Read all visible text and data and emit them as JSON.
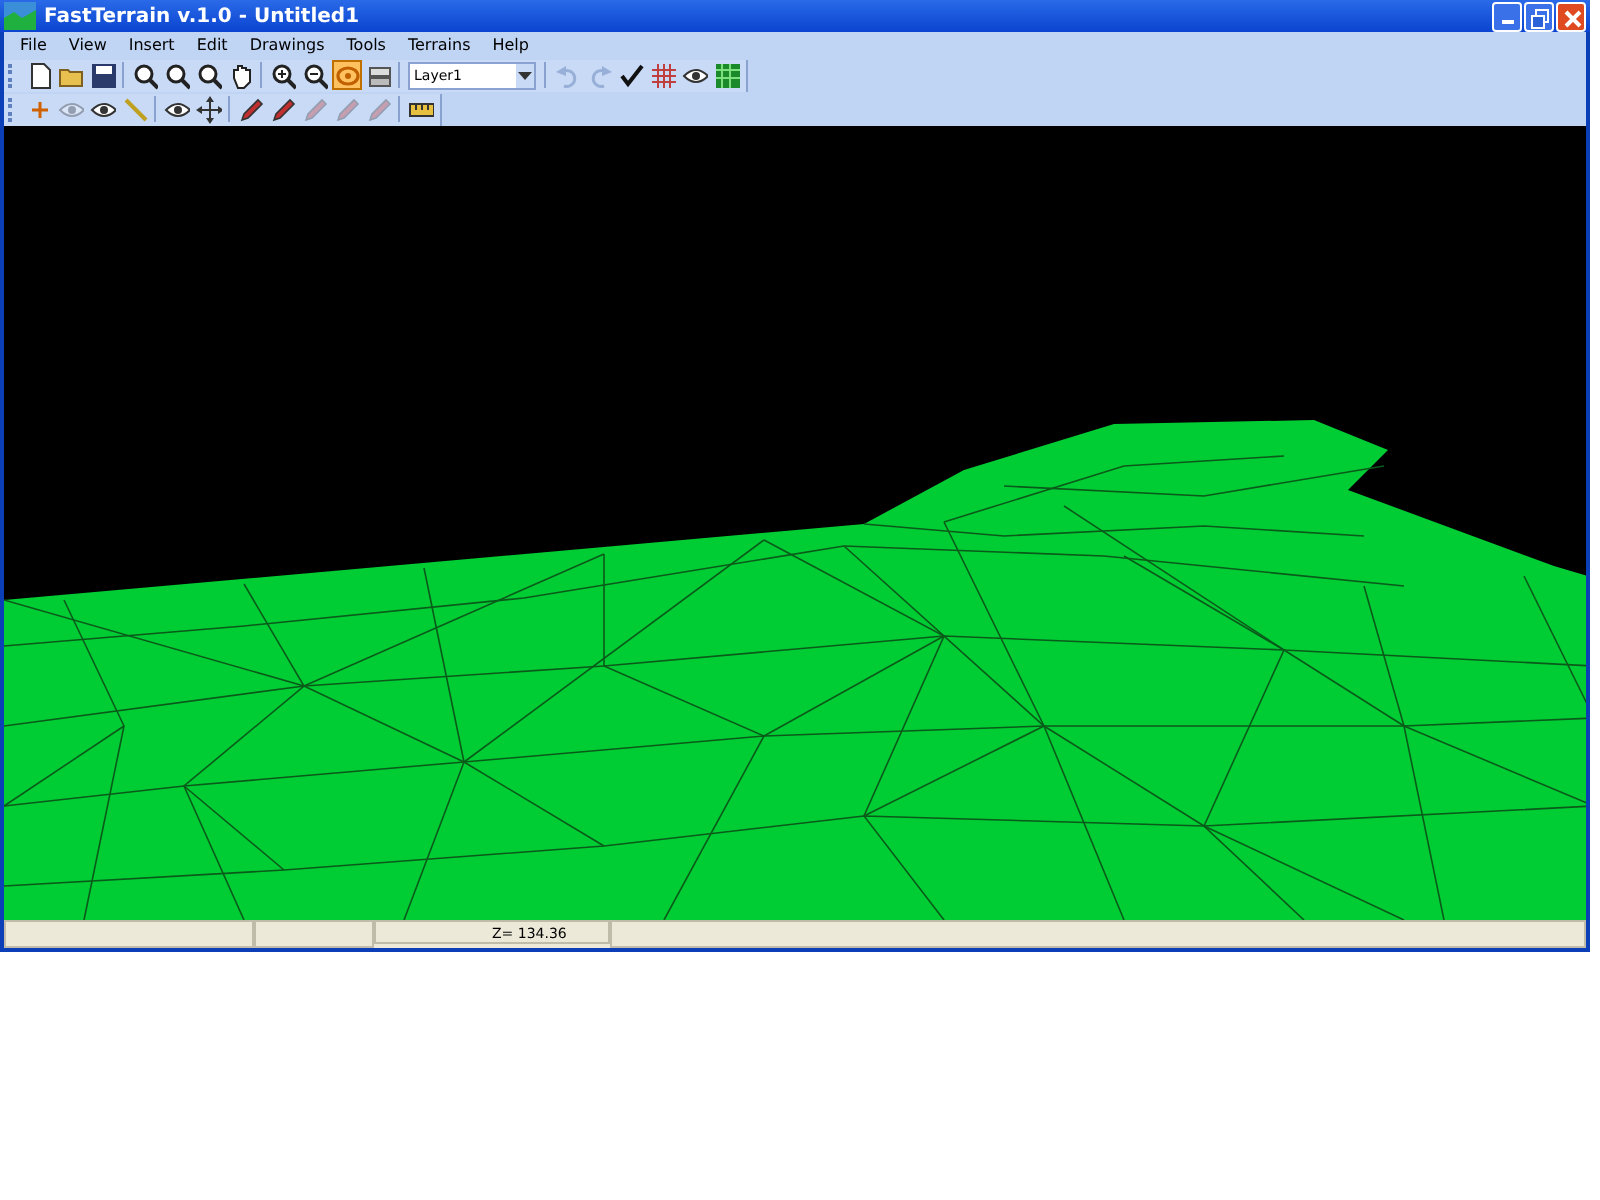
{
  "window": {
    "title": "FastTerrain v.1.0 - Untitled1"
  },
  "menu": [
    {
      "label": "File"
    },
    {
      "label": "View"
    },
    {
      "label": "Insert"
    },
    {
      "label": "Edit"
    },
    {
      "label": "Drawings"
    },
    {
      "label": "Tools"
    },
    {
      "label": "Terrains"
    },
    {
      "label": "Help"
    }
  ],
  "toolbar_main": {
    "buttons": [
      {
        "selected": false,
        "disabled": false
      },
      {
        "selected": false,
        "disabled": false
      },
      {
        "selected": false,
        "disabled": false
      },
      {
        "selected": false,
        "disabled": false
      },
      {
        "selected": false,
        "disabled": false
      },
      {
        "selected": false,
        "disabled": false
      },
      {
        "selected": false,
        "disabled": false
      },
      {
        "selected": false,
        "disabled": false
      },
      {
        "selected": false,
        "disabled": false
      },
      {
        "selected": true,
        "disabled": false
      },
      {
        "selected": false,
        "disabled": false
      }
    ],
    "layer_dropdown": {
      "value": "Layer1"
    },
    "buttons_after": [
      {
        "selected": false,
        "disabled": true
      },
      {
        "selected": false,
        "disabled": true
      },
      {
        "selected": false,
        "disabled": false
      },
      {
        "selected": false,
        "disabled": false
      },
      {
        "selected": false,
        "disabled": false
      },
      {
        "selected": false,
        "disabled": false
      }
    ]
  },
  "toolbar_draw": {
    "buttons": [
      {
        "disabled": false
      },
      {
        "disabled": true
      },
      {
        "disabled": false
      },
      {
        "disabled": false
      },
      {
        "disabled": false
      },
      {
        "disabled": false
      },
      {
        "disabled": false
      },
      {
        "disabled": false
      },
      {
        "disabled": true
      },
      {
        "disabled": true
      },
      {
        "disabled": true
      },
      {
        "disabled": false
      }
    ]
  },
  "status_bar": {
    "z_reading": "Z= 134.36"
  }
}
